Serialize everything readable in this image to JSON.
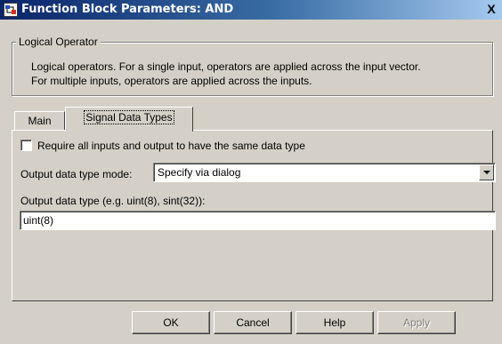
{
  "window": {
    "title": "Function Block Parameters: AND",
    "close_glyph": "X",
    "app_icon": "simulink-block-icon"
  },
  "group": {
    "legend": "Logical Operator",
    "description_line1": "Logical operators.  For a single input, operators are applied across the input vector.",
    "description_line2": "For multiple inputs, operators are applied across the inputs."
  },
  "tabs": [
    {
      "label": "Main",
      "selected": false
    },
    {
      "label": "Signal Data Types",
      "selected": true
    }
  ],
  "signal_data_types": {
    "same_type_checkbox_label": "Require all inputs and output to have the same data type",
    "same_type_checked": false,
    "output_mode_label": "Output data type mode:",
    "output_mode_value": "Specify via dialog",
    "output_type_label": "Output data type (e.g. uint(8), sint(32)):",
    "output_type_value": "uint(8)"
  },
  "buttons": {
    "ok": "OK",
    "cancel": "Cancel",
    "help": "Help",
    "apply": "Apply"
  },
  "colors": {
    "title_start": "#0a246a",
    "title_end": "#a6caf0",
    "face": "#d4d0c8",
    "disabled_text": "#808080"
  }
}
